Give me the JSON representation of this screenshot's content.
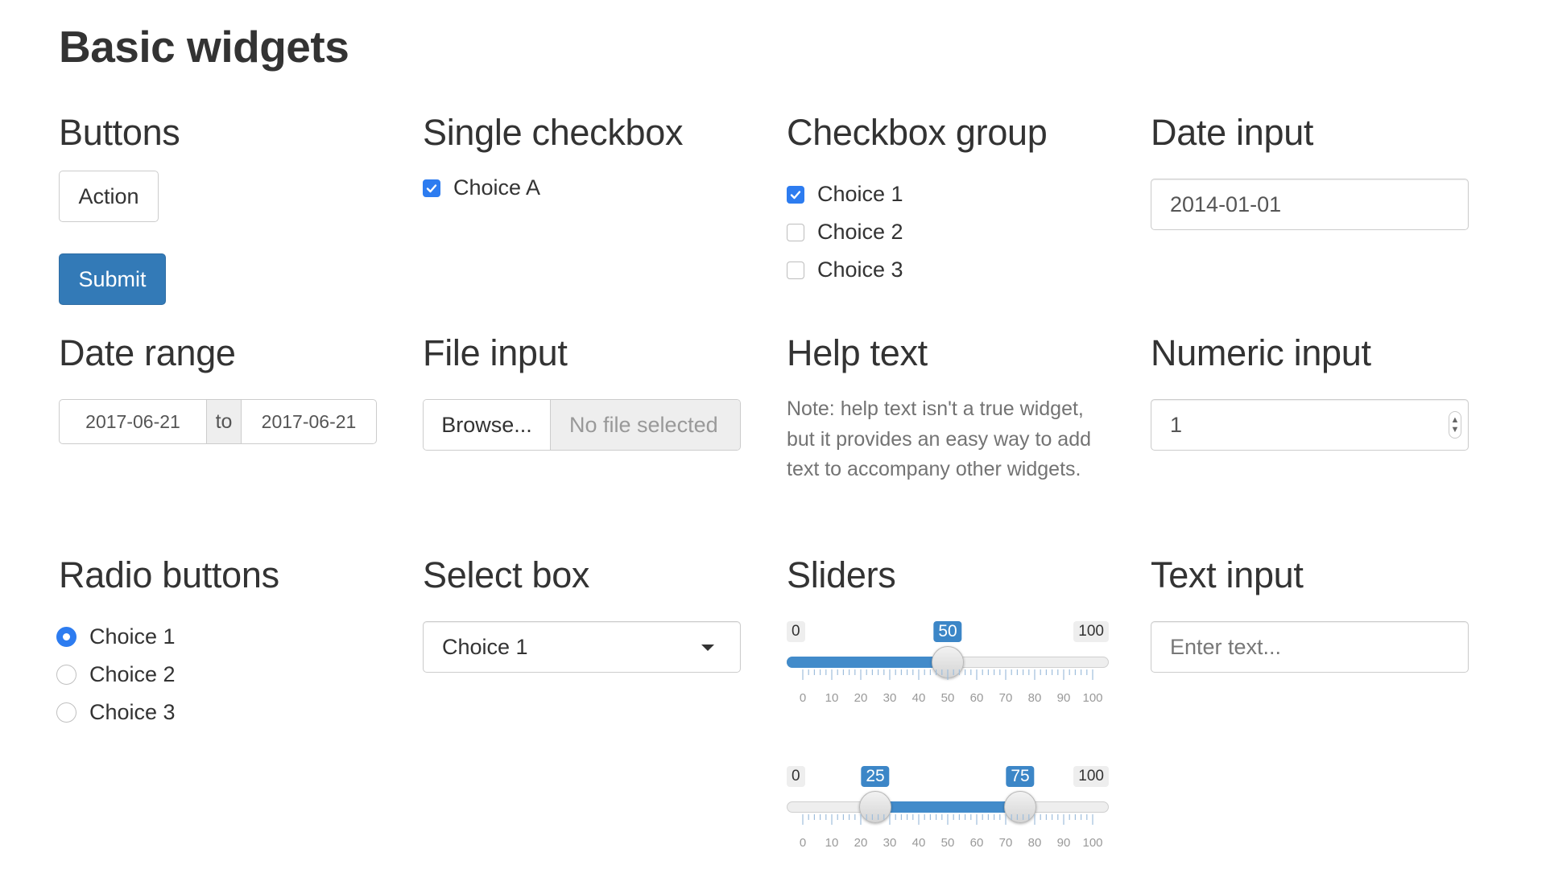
{
  "page_title": "Basic widgets",
  "sections": {
    "buttons": {
      "title": "Buttons",
      "action_label": "Action",
      "submit_label": "Submit"
    },
    "single_checkbox": {
      "title": "Single checkbox",
      "label": "Choice A",
      "checked": true
    },
    "checkbox_group": {
      "title": "Checkbox group",
      "items": [
        {
          "label": "Choice 1",
          "checked": true
        },
        {
          "label": "Choice 2",
          "checked": false
        },
        {
          "label": "Choice 3",
          "checked": false
        }
      ]
    },
    "date_input": {
      "title": "Date input",
      "value": "2014-01-01"
    },
    "date_range": {
      "title": "Date range",
      "start": "2017-06-21",
      "separator": "to",
      "end": "2017-06-21"
    },
    "file_input": {
      "title": "File input",
      "browse_label": "Browse...",
      "status": "No file selected"
    },
    "help_text": {
      "title": "Help text",
      "text": "Note: help text isn't a true widget, but it provides an easy way to add text to accompany other widgets."
    },
    "numeric_input": {
      "title": "Numeric input",
      "value": "1"
    },
    "radio_buttons": {
      "title": "Radio buttons",
      "items": [
        {
          "label": "Choice 1",
          "selected": true
        },
        {
          "label": "Choice 2",
          "selected": false
        },
        {
          "label": "Choice 3",
          "selected": false
        }
      ]
    },
    "select_box": {
      "title": "Select box",
      "selected": "Choice 1"
    },
    "sliders": {
      "title": "Sliders",
      "tick_labels": [
        "0",
        "10",
        "20",
        "30",
        "40",
        "50",
        "60",
        "70",
        "80",
        "90",
        "100"
      ],
      "single": {
        "min": 0,
        "max": 100,
        "value": 50,
        "min_label": "0",
        "max_label": "100",
        "value_label": "50"
      },
      "range": {
        "min": 0,
        "max": 100,
        "from": 25,
        "to": 75,
        "min_label": "0",
        "max_label": "100",
        "from_label": "25",
        "to_label": "75"
      }
    },
    "text_input": {
      "title": "Text input",
      "placeholder": "Enter text..."
    }
  },
  "colors": {
    "accent": "#337ab7",
    "checkbox_accent": "#2d7cf0",
    "slider_fill": "#428bca",
    "slider_badge": "#3c86c7"
  }
}
